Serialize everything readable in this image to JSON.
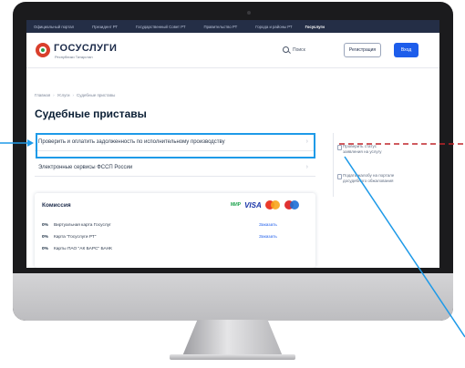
{
  "topbar": {
    "items": [
      "Официальный портал",
      "Президент РТ",
      "Государственный Совет РТ",
      "Правительство РТ",
      "Города и районы РТ",
      "Госуслуги"
    ]
  },
  "header": {
    "logo_title": "ГОСУСЛУГИ",
    "logo_subtitle": "Республики Татарстан",
    "search_label": "Поиск",
    "register_label": "Регистрация",
    "login_label": "Вход"
  },
  "breadcrumb": [
    "Главная",
    "Услуги",
    "Судебные приставы"
  ],
  "page_title": "Судебные приставы",
  "services": [
    "Проверить и оплатить задолженность по исполнительному производству",
    "Электронные сервисы ФССП России"
  ],
  "sidebar": {
    "links": [
      "Проверить статус заявления на услугу",
      "Подать жалобу на портале досудебного обжалования"
    ]
  },
  "commission": {
    "title": "Комиссия",
    "pay_logos": {
      "mir": "МИР",
      "visa": "VISA"
    },
    "rows": [
      {
        "percent": "0%",
        "label": "Виртуальная карта Госуслуг",
        "action": "Заказать"
      },
      {
        "percent": "0%",
        "label": "Карта \"Госуслуги РТ\"",
        "action": "Заказать"
      },
      {
        "percent": "0%",
        "label": "Карты ПАО \"АК БАРС\" БАНК",
        "action": ""
      }
    ]
  },
  "colors": {
    "topbar": "#242e46",
    "accent_blue": "#1d5deb",
    "highlight": "#1e9ae8",
    "dashed_arrow": "#c0252a",
    "logo_red": "#d93f2c"
  },
  "icons": [
    "search-icon",
    "chevron-right-icon",
    "document-icon",
    "mir-logo",
    "visa-logo",
    "mastercard-logo",
    "maestro-logo"
  ]
}
